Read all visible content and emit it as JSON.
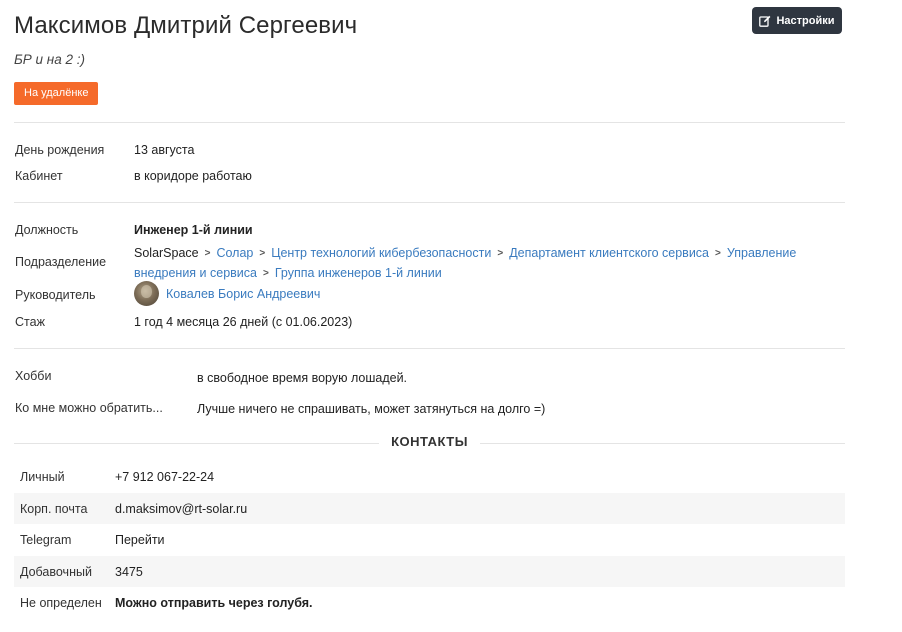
{
  "profile": {
    "name": "Максимов Дмитрий Сергеевич",
    "status_text": "БР и на 2 :)",
    "badge": "На удалёнке",
    "settings_label": "Настройки"
  },
  "personal": {
    "birthday_label": "День рождения",
    "birthday_value": "13 августа",
    "office_label": "Кабинет",
    "office_value": "в коридоре работаю"
  },
  "work": {
    "position_label": "Должность",
    "position_value": "Инженер 1-й линии",
    "department_label": "Подразделение",
    "department_path": [
      "SolarSpace",
      "Солар",
      "Центр технологий кибербезопасности",
      "Департамент клиентского сервиса",
      "Управление внедрения и сервиса",
      "Группа инженеров 1-й линии"
    ],
    "manager_label": "Руководитель",
    "manager_name": "Ковалев Борис Андреевич",
    "experience_label": "Стаж",
    "experience_value": "1 год 4 месяца 26 дней (с 01.06.2023)"
  },
  "about": {
    "hobby_label": "Хобби",
    "hobby_value": "в свободное время ворую лошадей.",
    "contact_when_label": "Ко мне можно обратить...",
    "contact_when_value": "Лучше ничего не спрашивать, может затянуться на долго =)"
  },
  "contacts": {
    "title": "КОНТАКТЫ",
    "rows": [
      {
        "label": "Личный",
        "value": "+7 912 067-22-24",
        "link": false
      },
      {
        "label": "Корп. почта",
        "value": "d.maksimov@rt-solar.ru",
        "link": true
      },
      {
        "label": "Telegram",
        "value": "Перейти",
        "link": true
      },
      {
        "label": "Добавочный",
        "value": "3475",
        "link": false
      },
      {
        "label": "Не определен",
        "value": "Можно отправить через голубя.",
        "link": false,
        "bold": true
      }
    ]
  },
  "colors": {
    "badge": "#f56a2a",
    "settings_button": "#2f3640",
    "link": "#3a7bbf",
    "zebra": "#f6f6f6"
  }
}
